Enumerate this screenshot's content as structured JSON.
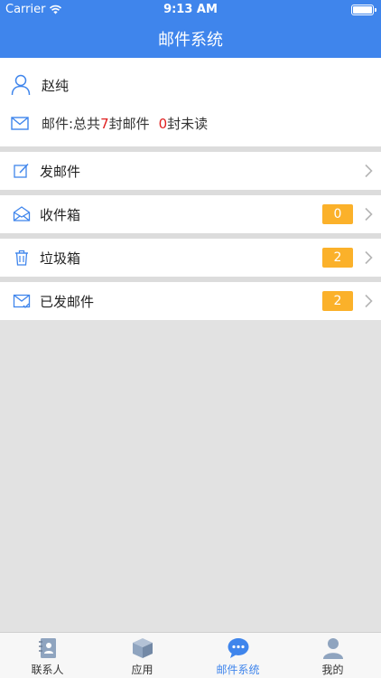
{
  "status": {
    "carrier": "Carrier",
    "time": "9:13 AM"
  },
  "nav": {
    "title": "邮件系统"
  },
  "user": {
    "name": "赵纯",
    "mail_prefix": "邮件:总共",
    "total_count": "7",
    "total_suffix": "封邮件",
    "unread_count": "0",
    "unread_suffix": "封未读"
  },
  "menu": [
    {
      "label": "发邮件",
      "icon": "compose-icon"
    },
    {
      "label": "收件箱",
      "icon": "inbox-icon",
      "badge": "0"
    },
    {
      "label": "垃圾箱",
      "icon": "trash-icon",
      "badge": "2"
    },
    {
      "label": "已发邮件",
      "icon": "sent-mail-icon",
      "badge": "2"
    }
  ],
  "tabs": [
    {
      "label": "联系人",
      "icon": "contacts-icon"
    },
    {
      "label": "应用",
      "icon": "apps-box-icon"
    },
    {
      "label": "邮件系统",
      "icon": "chat-bubble-icon",
      "active": true
    },
    {
      "label": "我的",
      "icon": "profile-icon"
    }
  ],
  "colors": {
    "primary": "#3f85ec",
    "badge": "#fbb12a",
    "highlight": "#e02020",
    "background": "#e2e2e2"
  }
}
